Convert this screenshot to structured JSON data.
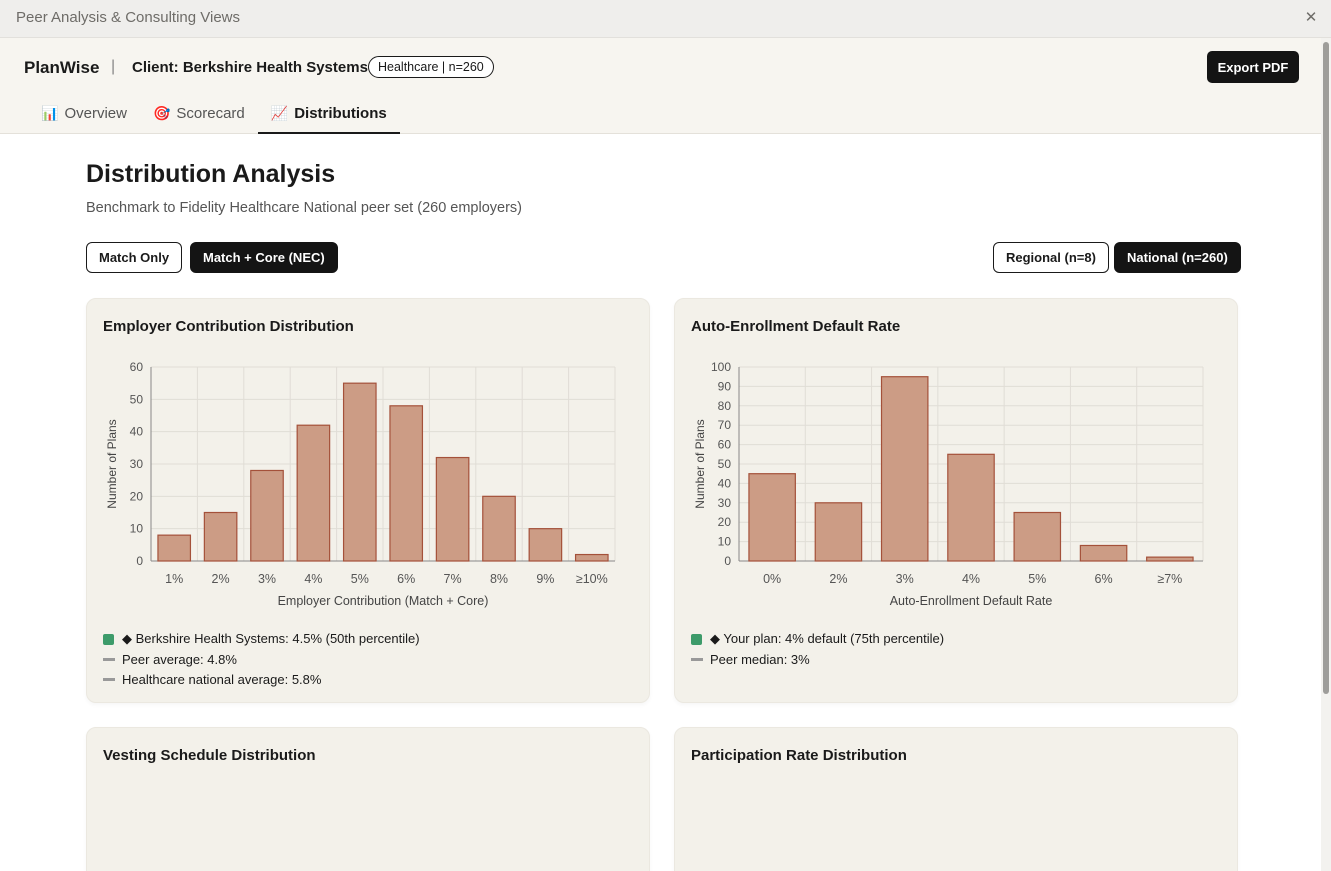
{
  "window": {
    "title": "Peer Analysis & Consulting Views"
  },
  "header": {
    "brand": "PlanWise",
    "separator": "|",
    "client": "Client: Berkshire Health Systems",
    "badge": "Healthcare | n=260",
    "export_label": "Export PDF"
  },
  "tabs": [
    {
      "icon": "📊",
      "label": "Overview"
    },
    {
      "icon": "🎯",
      "label": "Scorecard"
    },
    {
      "icon": "📈",
      "label": "Distributions",
      "active": true
    }
  ],
  "main": {
    "title": "Distribution Analysis",
    "subtitle": "Benchmark to Fidelity Healthcare National peer set (260 employers)",
    "contribution_toggles": [
      "Match Only",
      "Match + Core (NEC)"
    ],
    "contribution_selected": "Match + Core (NEC)",
    "peer_toggles": [
      "Regional (n=8)",
      "National (n=260)"
    ],
    "peer_selected": "National (n=260)"
  },
  "cards": {
    "contribution": {
      "title": "Employer Contribution Distribution",
      "legend": [
        {
          "kind": "marker",
          "text": "◆ Berkshire Health Systems: 4.5% (50th percentile)",
          "color": "#3d9b6a"
        },
        {
          "kind": "line",
          "text": "Peer average: 4.8%",
          "color": "#999999"
        },
        {
          "kind": "line",
          "text": "Healthcare national average: 5.8%",
          "color": "#999999"
        }
      ]
    },
    "auto_enroll": {
      "title": "Auto-Enrollment Default Rate",
      "legend": [
        {
          "kind": "marker",
          "text": "◆ Your plan: 4% default (75th percentile)",
          "color": "#3d9b6a"
        },
        {
          "kind": "line",
          "text": "Peer median: 3%",
          "color": "#999999"
        }
      ]
    },
    "vesting": {
      "title": "Vesting Schedule Distribution"
    },
    "participation": {
      "title": "Participation Rate Distribution"
    }
  },
  "colors": {
    "bar_fill": "#cc9c85",
    "bar_stroke": "#a4513a",
    "grid": "#e0ddd6",
    "accent_dark": "#141414",
    "marker_green": "#3d9b6a"
  },
  "chart_data": [
    {
      "id": "contribution",
      "type": "bar",
      "categories": [
        "1%",
        "2%",
        "3%",
        "4%",
        "5%",
        "6%",
        "7%",
        "8%",
        "9%",
        "≥10%"
      ],
      "values": [
        8,
        15,
        28,
        42,
        55,
        48,
        32,
        20,
        10,
        2
      ],
      "xlabel": "Employer Contribution (Match + Core)",
      "ylabel": "Number of Plans",
      "ylim": [
        0,
        60
      ],
      "yticks": [
        0,
        10,
        20,
        30,
        40,
        50,
        60
      ],
      "grid": true
    },
    {
      "id": "auto_enroll",
      "type": "bar",
      "categories": [
        "0%",
        "2%",
        "3%",
        "4%",
        "5%",
        "6%",
        "≥7%"
      ],
      "values": [
        45,
        30,
        95,
        55,
        25,
        8,
        2
      ],
      "xlabel": "Auto-Enrollment Default Rate",
      "ylabel": "Number of Plans",
      "ylim": [
        0,
        100
      ],
      "yticks": [
        0,
        10,
        20,
        30,
        40,
        50,
        60,
        70,
        80,
        90,
        100
      ],
      "grid": true
    }
  ]
}
